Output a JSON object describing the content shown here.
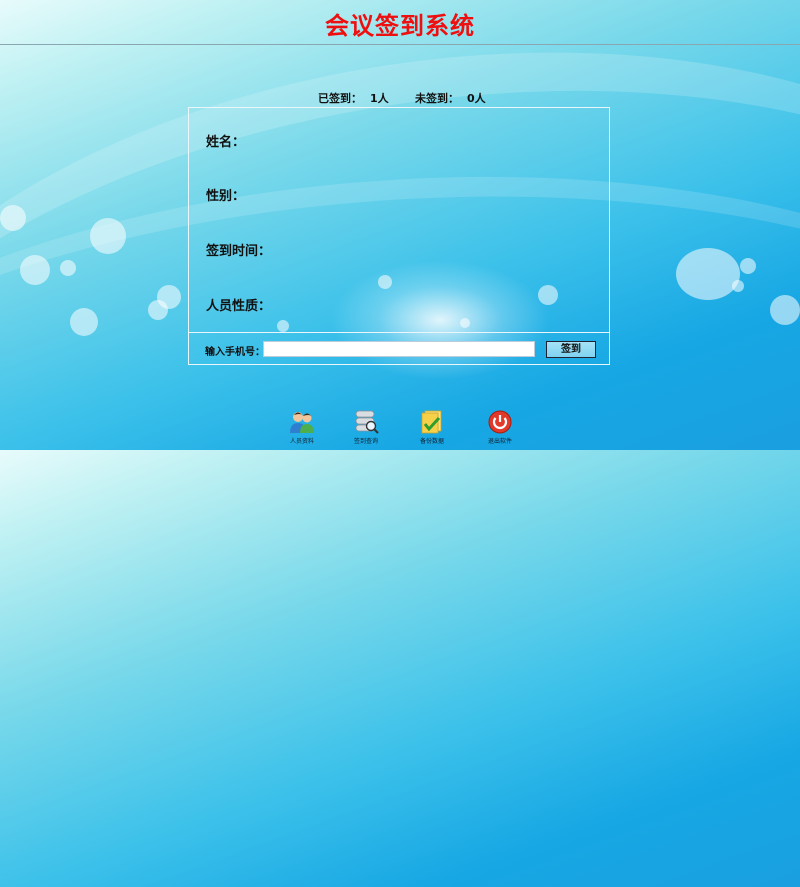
{
  "window": {
    "title": "会议签到系统"
  },
  "stats": {
    "signed_label": "已签到：",
    "signed_value": "1人",
    "unsigned_label": "未签到：",
    "unsigned_value": "0人"
  },
  "fields": {
    "name": "姓名：",
    "gender": "性别：",
    "time": "签到时间：",
    "nature": "人员性质："
  },
  "phone": {
    "label": "输入手机号：",
    "value": "",
    "button": "签到"
  },
  "toolbar": [
    {
      "label": "人员资料",
      "icon": "people-icon"
    },
    {
      "label": "签到查询",
      "icon": "database-search-icon"
    },
    {
      "label": "备份数据",
      "icon": "backup-check-icon"
    },
    {
      "label": "退出软件",
      "icon": "power-icon"
    }
  ],
  "colors": {
    "title": "#ee1010",
    "background_accent": "#1a9fe0"
  }
}
